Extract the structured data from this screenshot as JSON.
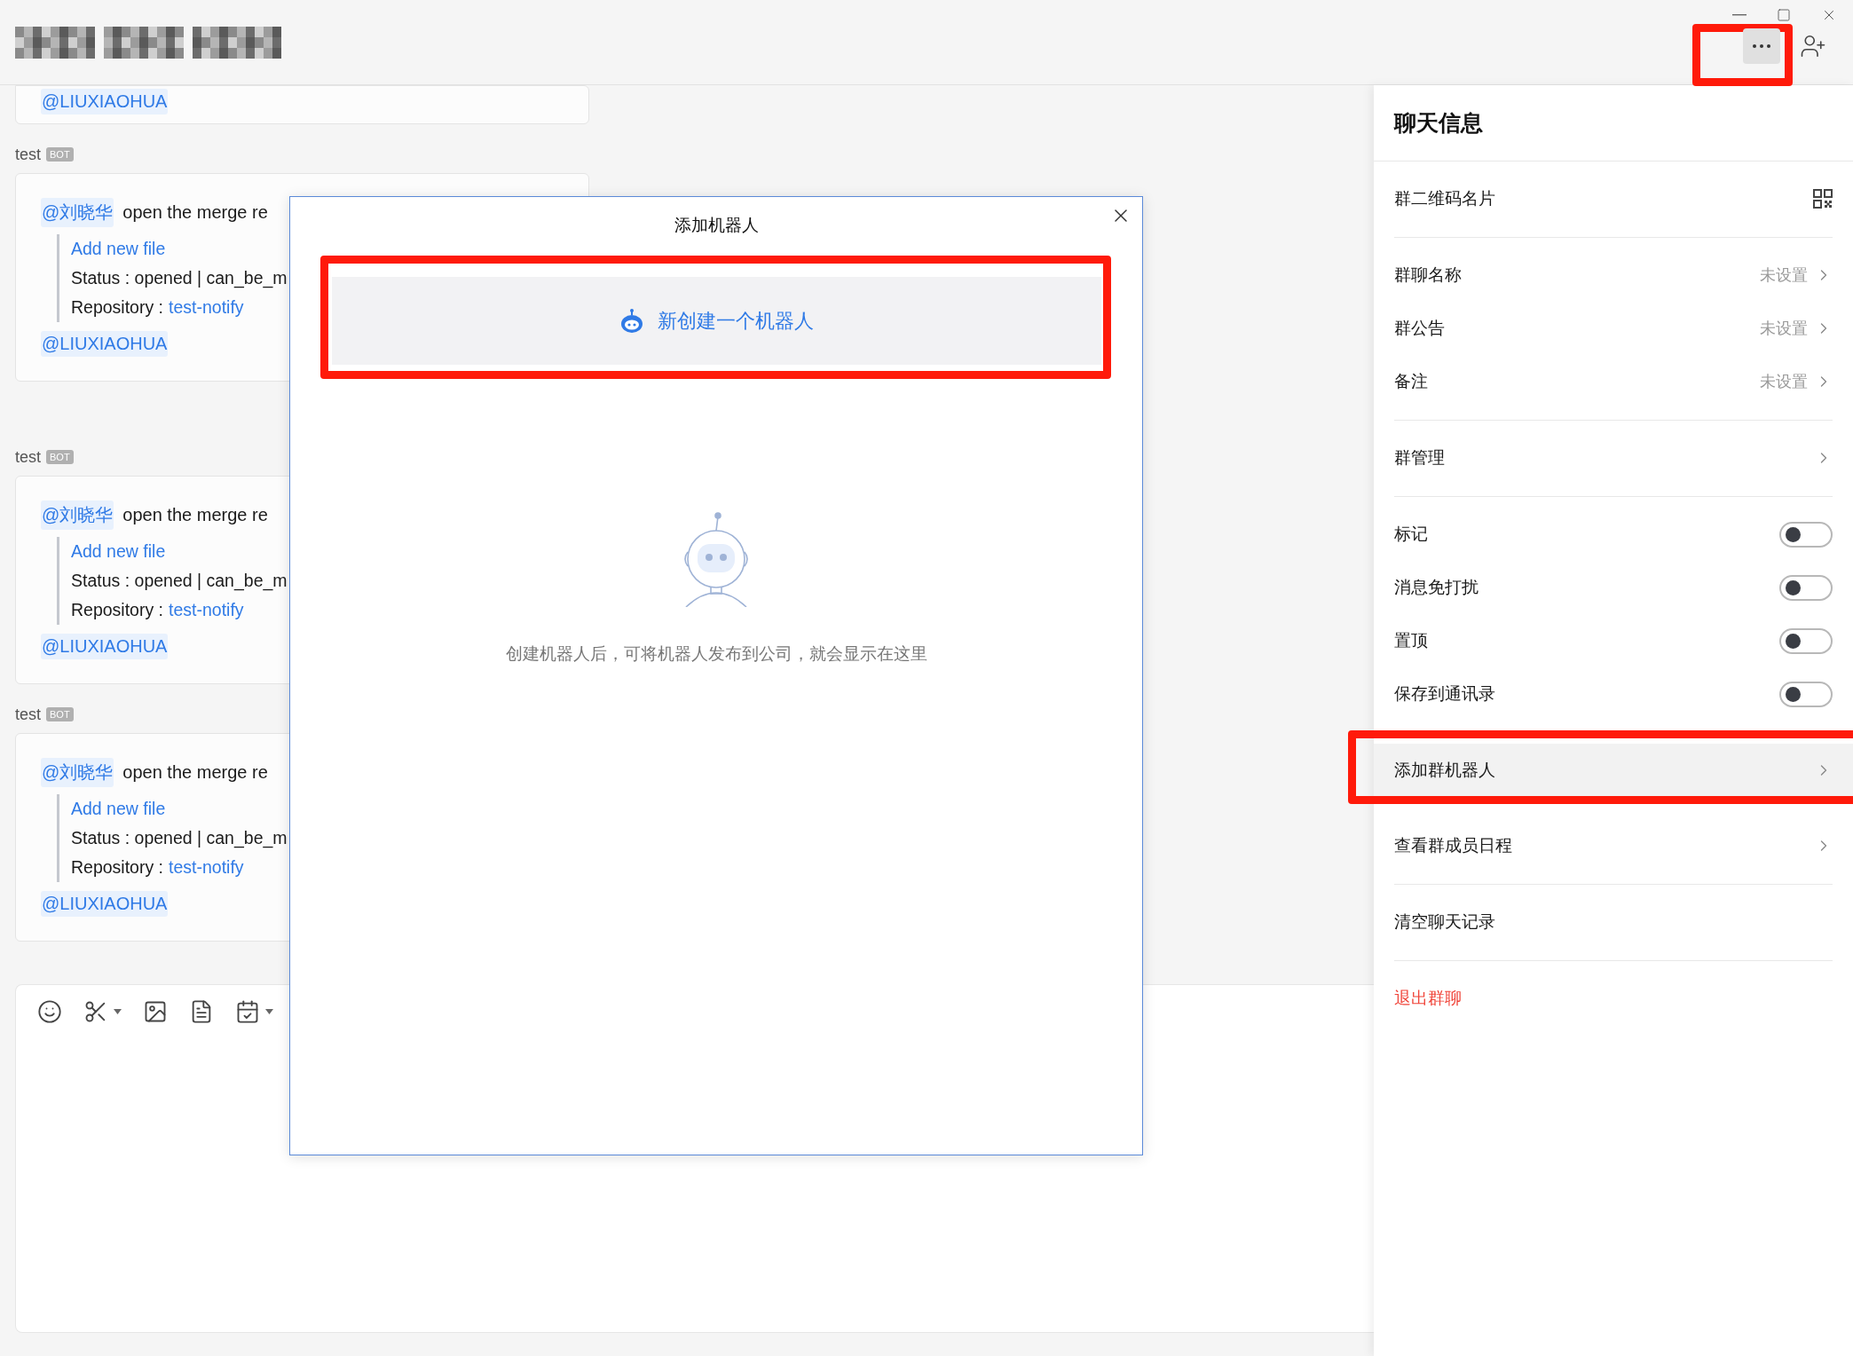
{
  "chat": {
    "messages": [
      {
        "kind": "partial",
        "trailing_mention": "@LIUXIAOHUA"
      },
      {
        "kind": "full",
        "sender": "test",
        "badge": "BOT",
        "mention": "@刘晓华",
        "text": "open the merge re",
        "link": "Add new file",
        "status": "Status : opened | can_be_m",
        "repo_label": "Repository :",
        "repo_link": "test-notify",
        "trailing_mention": "@LIUXIAOHUA"
      },
      {
        "kind": "full",
        "sender": "test",
        "badge": "BOT",
        "mention": "@刘晓华",
        "text": "open the merge re",
        "link": "Add new file",
        "status": "Status : opened | can_be_m",
        "repo_label": "Repository :",
        "repo_link": "test-notify",
        "trailing_mention": "@LIUXIAOHUA"
      },
      {
        "kind": "full",
        "sender": "test",
        "badge": "BOT",
        "mention": "@刘晓华",
        "text": "open the merge re",
        "link": "Add new file",
        "status": "Status : opened | can_be_m",
        "repo_label": "Repository :",
        "repo_link": "test-notify",
        "trailing_mention": "@LIUXIAOHUA"
      }
    ]
  },
  "modal": {
    "title": "添加机器人",
    "create_button": "新创建一个机器人",
    "hint": "创建机器人后，可将机器人发布到公司，就会显示在这里"
  },
  "panel": {
    "title": "聊天信息",
    "sections": [
      [
        {
          "kind": "qr",
          "label": "群二维码名片",
          "highlighted": false
        }
      ],
      [
        {
          "kind": "link",
          "label": "群聊名称",
          "value": "未设置",
          "highlighted": false
        },
        {
          "kind": "link",
          "label": "群公告",
          "value": "未设置",
          "highlighted": false
        },
        {
          "kind": "link",
          "label": "备注",
          "value": "未设置",
          "highlighted": false
        }
      ],
      [
        {
          "kind": "link",
          "label": "群管理",
          "highlighted": false
        }
      ],
      [
        {
          "kind": "toggle",
          "label": "标记",
          "on": false,
          "highlighted": false
        },
        {
          "kind": "toggle",
          "label": "消息免打扰",
          "on": false,
          "highlighted": false
        },
        {
          "kind": "toggle",
          "label": "置顶",
          "on": false,
          "highlighted": false
        },
        {
          "kind": "toggle",
          "label": "保存到通讯录",
          "on": false,
          "highlighted": false
        }
      ],
      [
        {
          "kind": "link",
          "label": "添加群机器人",
          "highlighted": true
        },
        {
          "kind": "link",
          "label": "查看群成员日程",
          "highlighted": false
        }
      ],
      [
        {
          "kind": "plain",
          "label": "清空聊天记录",
          "highlighted": false
        }
      ],
      [
        {
          "kind": "danger",
          "label": "退出群聊",
          "highlighted": false
        }
      ]
    ]
  }
}
